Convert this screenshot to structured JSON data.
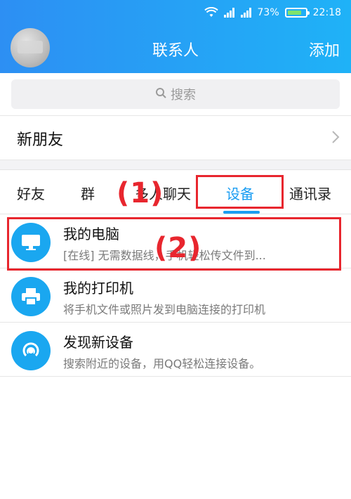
{
  "status_bar": {
    "signal_text": "73%",
    "time": "22:18",
    "battery_percent": 0.73
  },
  "header": {
    "title": "联系人",
    "add_label": "添加"
  },
  "search": {
    "placeholder": "搜索"
  },
  "new_friends": {
    "label": "新朋友"
  },
  "tabs": [
    {
      "label": "好友"
    },
    {
      "label": "群"
    },
    {
      "label": "多人聊天"
    },
    {
      "label": "设备"
    },
    {
      "label": "通讯录"
    }
  ],
  "active_tab": "设备",
  "devices": [
    {
      "name": "我的电脑",
      "desc": "[在线] 无需数据线，手机轻松传文件到...",
      "icon": "monitor-icon"
    },
    {
      "name": "我的打印机",
      "desc": "将手机文件或照片发到电脑连接的打印机",
      "icon": "printer-icon"
    },
    {
      "name": "发现新设备",
      "desc": "搜索附近的设备，用QQ轻松连接设备。",
      "icon": "radar-icon"
    }
  ],
  "annotations": {
    "label_1": "(1)",
    "label_2": "(2)"
  },
  "colors": {
    "accent": "#1a9df2",
    "header_start": "#2d8ff3",
    "header_end": "#1fb2f7",
    "annotation": "#e8262e"
  }
}
